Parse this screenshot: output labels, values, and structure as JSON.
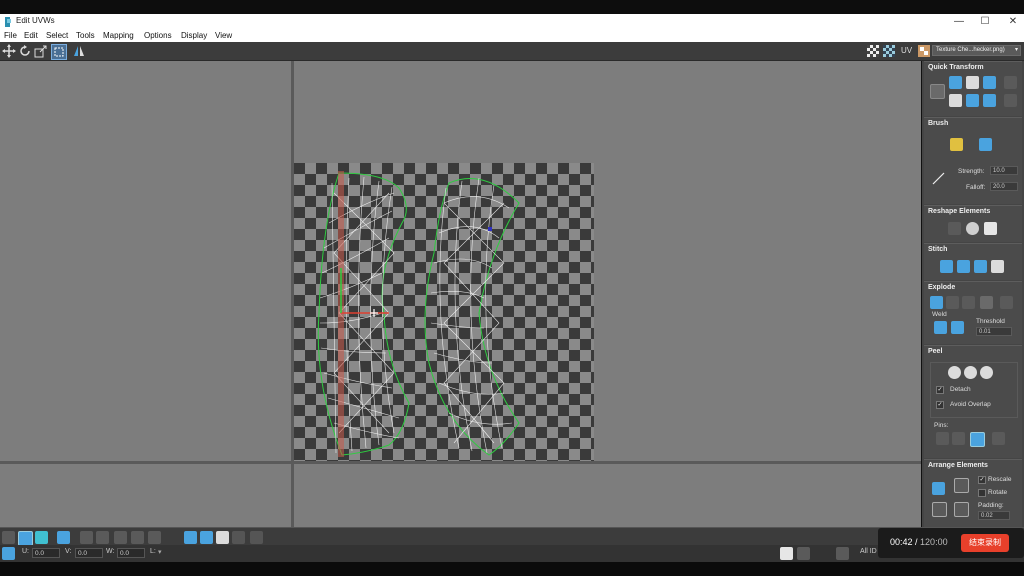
{
  "window": {
    "title": "Edit UVWs",
    "controls": {
      "minimize": "—",
      "maximize": "☐",
      "close": "✕"
    }
  },
  "menu": [
    "File",
    "Edit",
    "Select",
    "Tools",
    "Mapping",
    "Options",
    "Display",
    "View"
  ],
  "toolbar": {
    "uv_label": "UV",
    "texture_dropdown": "Texture Che...hecker.png)"
  },
  "panel": {
    "quick_transform": {
      "title": "Quick Transform"
    },
    "brush": {
      "title": "Brush",
      "strength_label": "Strength:",
      "strength_value": "10.0",
      "falloff_label": "Falloff:",
      "falloff_value": "20.0"
    },
    "reshape": {
      "title": "Reshape Elements"
    },
    "stitch": {
      "title": "Stitch"
    },
    "explode": {
      "title": "Explode",
      "weld_label": "Weld",
      "threshold_label": "Threshold",
      "threshold_value": "0.01"
    },
    "peel": {
      "title": "Peel",
      "detach_label": "Detach",
      "avoid_overlap_label": "Avoid Overlap",
      "pins_label": "Pins:"
    },
    "arrange": {
      "title": "Arrange Elements",
      "rescale_label": "Rescale",
      "rotate_label": "Rotate",
      "padding_label": "Padding:",
      "padding_value": "0.02"
    }
  },
  "status": {
    "u_label": "U:",
    "u_value": "0.0",
    "v_label": "V:",
    "v_value": "0.0",
    "w_label": "W:",
    "w_value": "0.0",
    "l_label": "L:",
    "all_ids_label": "All ID"
  },
  "recorder": {
    "elapsed": "00:42",
    "separator": " / ",
    "total": "120:00",
    "stop_label": "结束录制"
  },
  "colors": {
    "accent": "#4aa3df",
    "stop": "#e8402b",
    "seam": "#c85a4a",
    "uv_edge": "#2ecc40"
  }
}
